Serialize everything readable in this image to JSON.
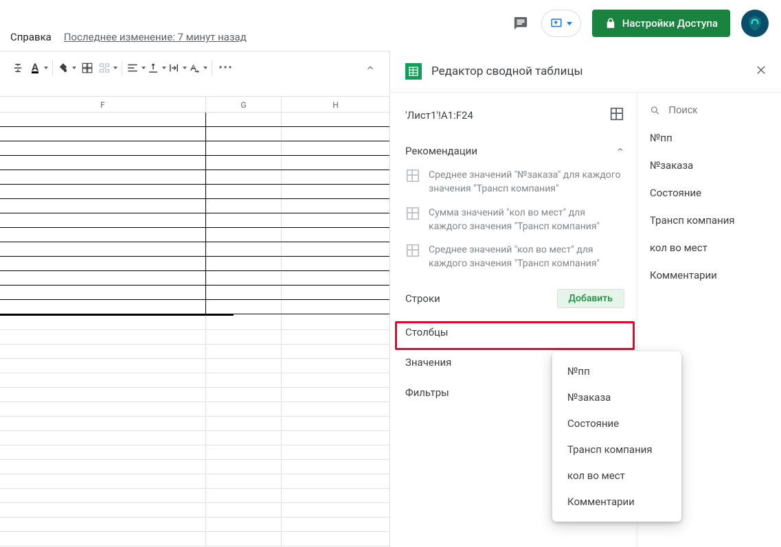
{
  "menu": {
    "help": "Справка",
    "last_change": "Последнее изменение: 7 минут назад"
  },
  "share": {
    "label": "Настройки Доступа"
  },
  "columns": {
    "F": "F",
    "G": "G",
    "H": "H"
  },
  "panel": {
    "title": "Редактор сводной таблицы",
    "range": "'Лист1'!A1:F24",
    "recommend": "Рекомендации",
    "suggestions": [
      "Среднее значений \"№заказа\" для каждого значения \"Трансп компания\"",
      "Сумма значений \"кол во мест\" для каждого значения \"Трансп компания\"",
      "Среднее значений \"кол во мест\" для каждого значения \"Трансп компания\""
    ],
    "rows": "Строки",
    "cols": "Столбцы",
    "values": "Значения",
    "filters": "Фильтры",
    "add": "Добавить",
    "search_ph": "Поиск",
    "fields": [
      "№пп",
      "№заказа",
      "Состояние",
      "Трансп компания",
      "кол во мест",
      "Комментарии"
    ],
    "menu_fields": [
      "№пп",
      "№заказа",
      "Состояние",
      "Трансп компания",
      "кол во мест",
      "Комментарии"
    ]
  }
}
